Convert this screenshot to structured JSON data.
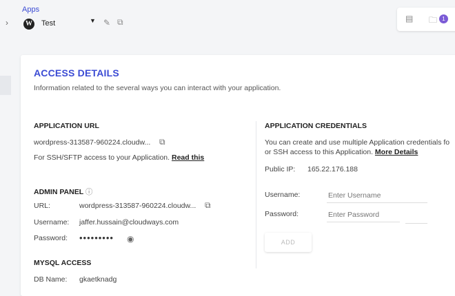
{
  "header": {
    "apps_label": "Apps",
    "app_name": "Test",
    "notification_count": "1"
  },
  "access": {
    "title": "ACCESS DETAILS",
    "subtitle": "Information related to the several ways you can interact with your application."
  },
  "app_url": {
    "heading": "APPLICATION URL",
    "url": "wordpress-313587-960224.cloudw...",
    "ssh_text": "For SSH/SFTP access to your Application.",
    "ssh_link": "Read this"
  },
  "admin_panel": {
    "heading": "ADMIN PANEL",
    "info_icon": "ⓘ",
    "url_label": "URL:",
    "url_value": "wordpress-313587-960224.cloudw...",
    "username_label": "Username:",
    "username_value": "jaffer.hussain@cloudways.com",
    "password_label": "Password:",
    "password_value": "•••••••••"
  },
  "mysql": {
    "heading": "MYSQL ACCESS",
    "dbname_label": "DB Name:",
    "dbname_value": "gkaetknadg"
  },
  "credentials": {
    "heading": "APPLICATION CREDENTIALS",
    "desc_line1": "You can create and use multiple Application credentials fo",
    "desc_line2": "or SSH access to this Application.",
    "more_link": "More Details",
    "public_ip_label": "Public IP:",
    "public_ip_value": "165.22.176.188",
    "username_label": "Username:",
    "username_placeholder": "Enter Username",
    "password_label": "Password:",
    "password_placeholder": "Enter Password",
    "add_label": "ADD"
  }
}
